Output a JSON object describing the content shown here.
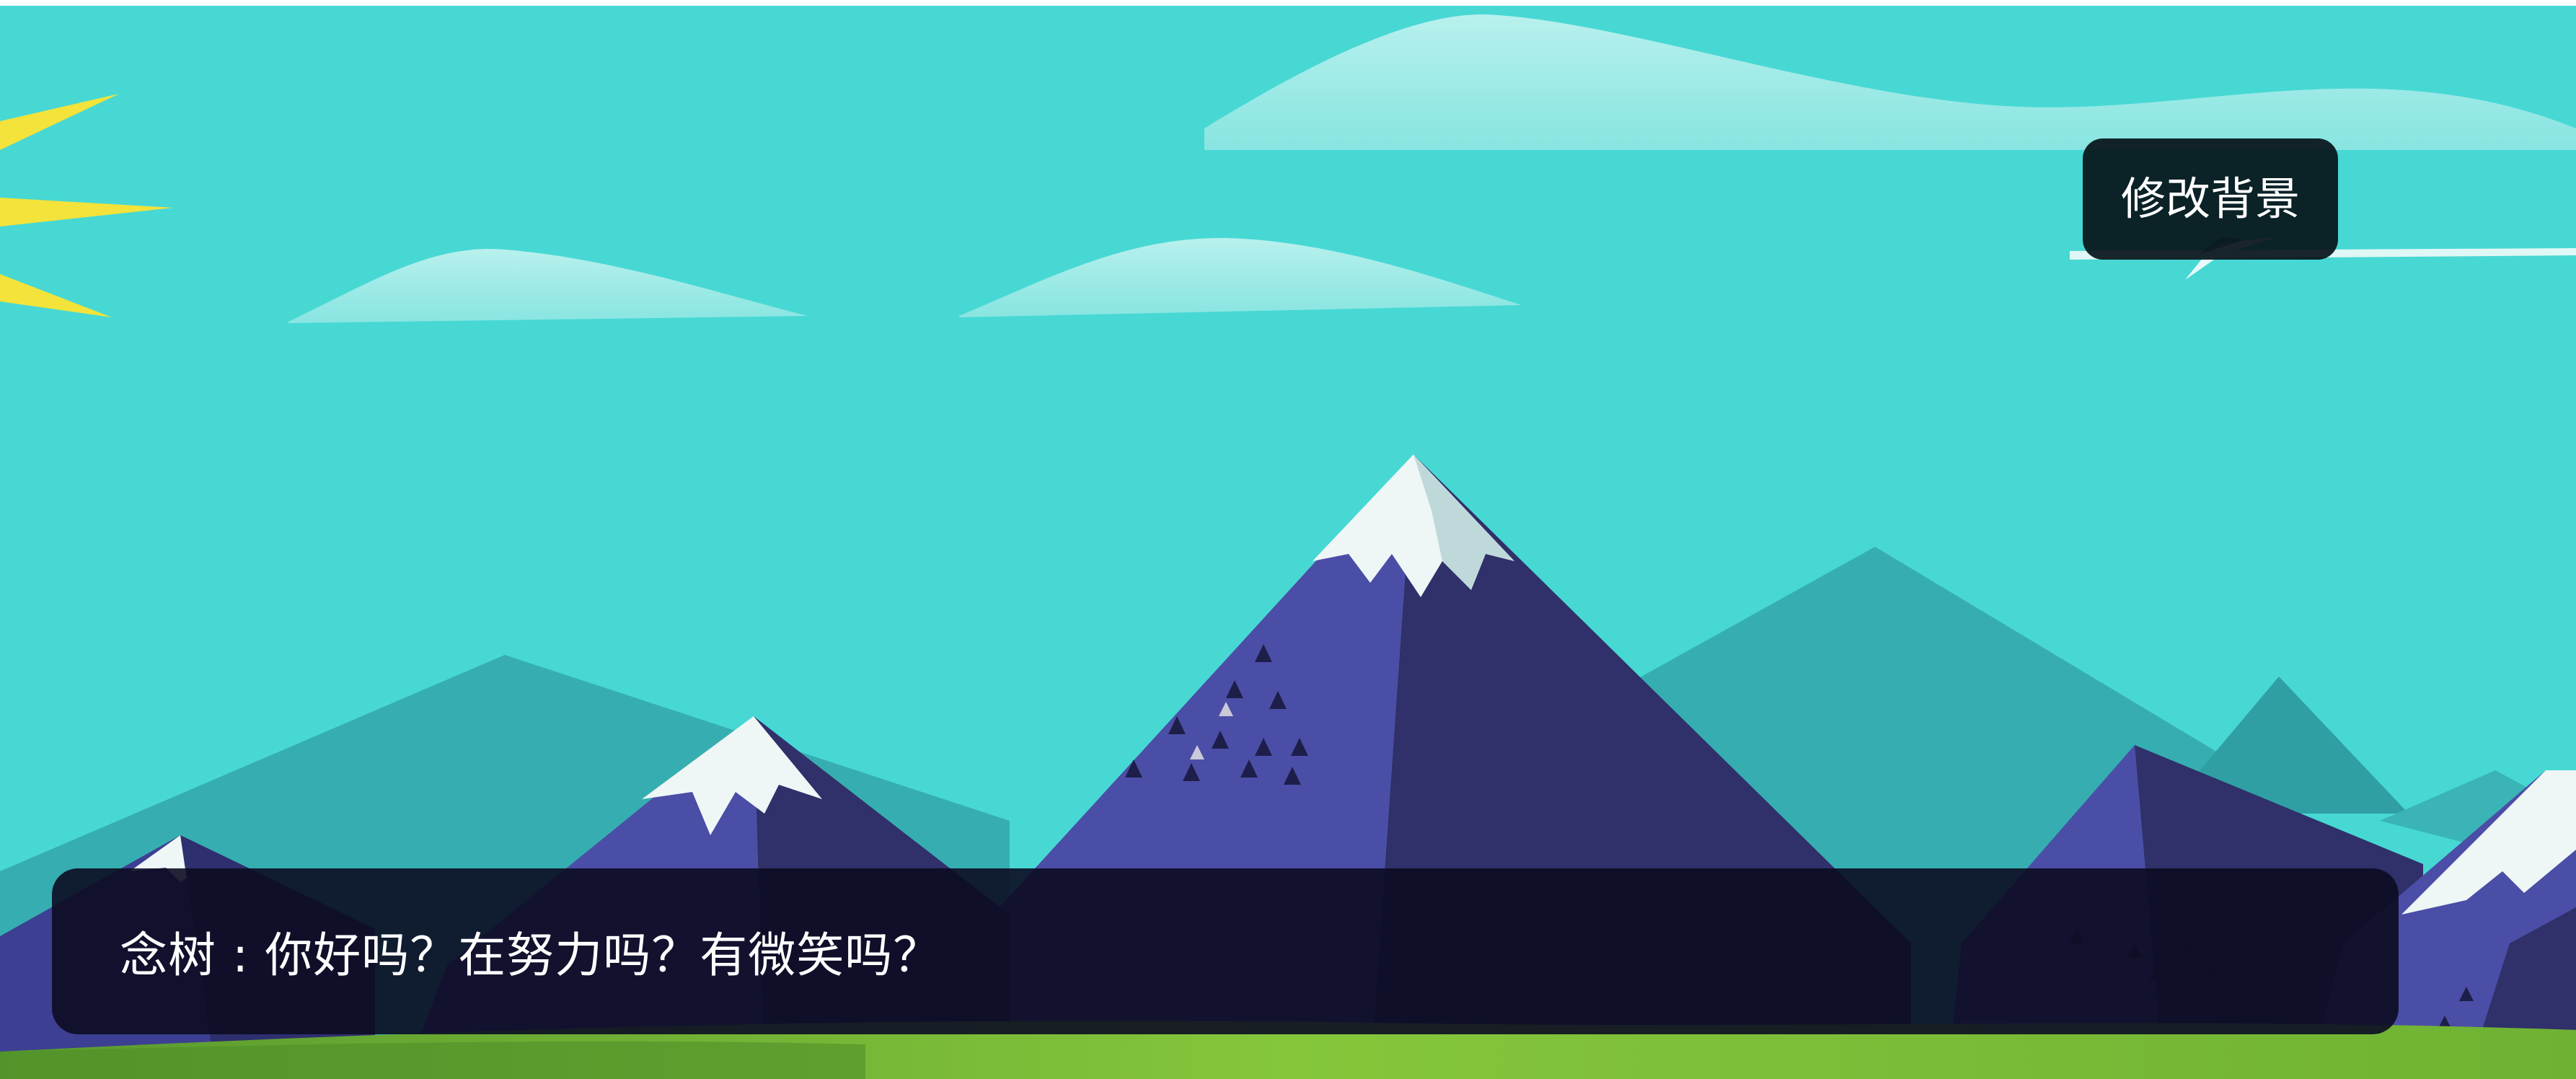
{
  "background": {
    "sky_color": "#47d8d4",
    "accent_sun_color": "#f3e33a",
    "grass_color": "#85c63b"
  },
  "toolbar": {
    "change_background_label": "修改背景"
  },
  "dialog": {
    "text": "念树 : 你好吗？在努力吗？有微笑吗？"
  }
}
